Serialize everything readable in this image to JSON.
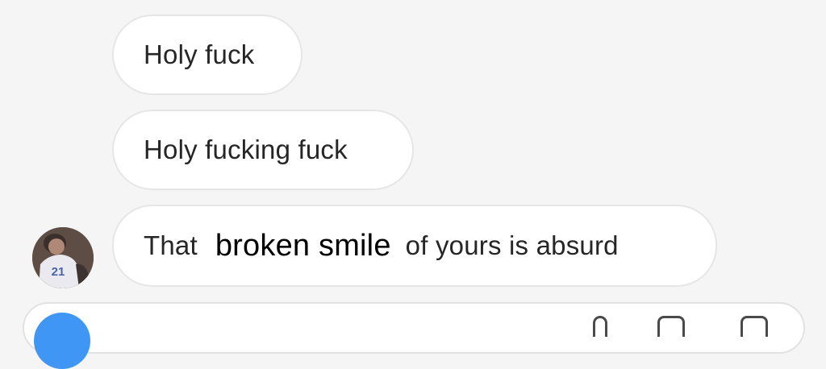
{
  "messages": [
    {
      "text": "Holy fuck"
    },
    {
      "text": "Holy fucking fuck"
    },
    {
      "before": "That",
      "edited": "broken smile",
      "after": "of yours is absurd"
    }
  ],
  "avatar": {
    "jersey_number": "21"
  },
  "colors": {
    "background": "#f5f5f5",
    "bubble": "#ffffff",
    "bubble_border": "#e6e6e6",
    "text": "#262626",
    "camera_button": "#3f96f4"
  },
  "icons": [
    "camera-icon",
    "microphone-icon",
    "image-icon",
    "more-icon"
  ]
}
